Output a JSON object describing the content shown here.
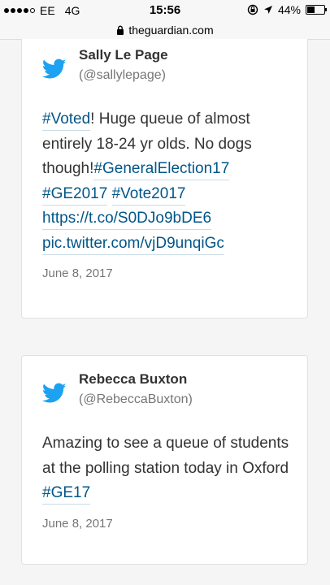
{
  "status_bar": {
    "carrier": "EE",
    "network": "4G",
    "time": "15:56",
    "battery_percent": "44%",
    "battery_level": 0.44
  },
  "browser": {
    "url": "theguardian.com"
  },
  "tweets": [
    {
      "name": "Sally Le Page",
      "handle": "(@sallylepage)",
      "text_parts": {
        "hashtag_voted": "#Voted",
        "text_1": "! Huge queue of almost entirely 18-24 yr olds. No dogs though!",
        "hashtag_general_election": "#GeneralElection17",
        "hashtag_ge2017": "#GE2017",
        "hashtag_vote2017": "#Vote2017",
        "link_1": "https://t.co/S0DJo9bDE6",
        "link_2": "pic.twitter.com/vjD9unqiGc"
      },
      "date": "June 8, 2017"
    },
    {
      "name": "Rebecca Buxton",
      "handle": "(@RebeccaBuxton)",
      "text_parts": {
        "text_1": "Amazing to see a queue of students at the polling station today in Oxford ",
        "hashtag_ge17": "#GE17"
      },
      "date": "June 8, 2017"
    }
  ],
  "colors": {
    "twitter_blue": "#1da1f2",
    "link_blue": "#005689"
  },
  "icons": {
    "twitter": "twitter-bird-icon",
    "lock": "lock-icon",
    "location": "location-arrow-icon",
    "rotation_lock": "rotation-lock-icon"
  }
}
